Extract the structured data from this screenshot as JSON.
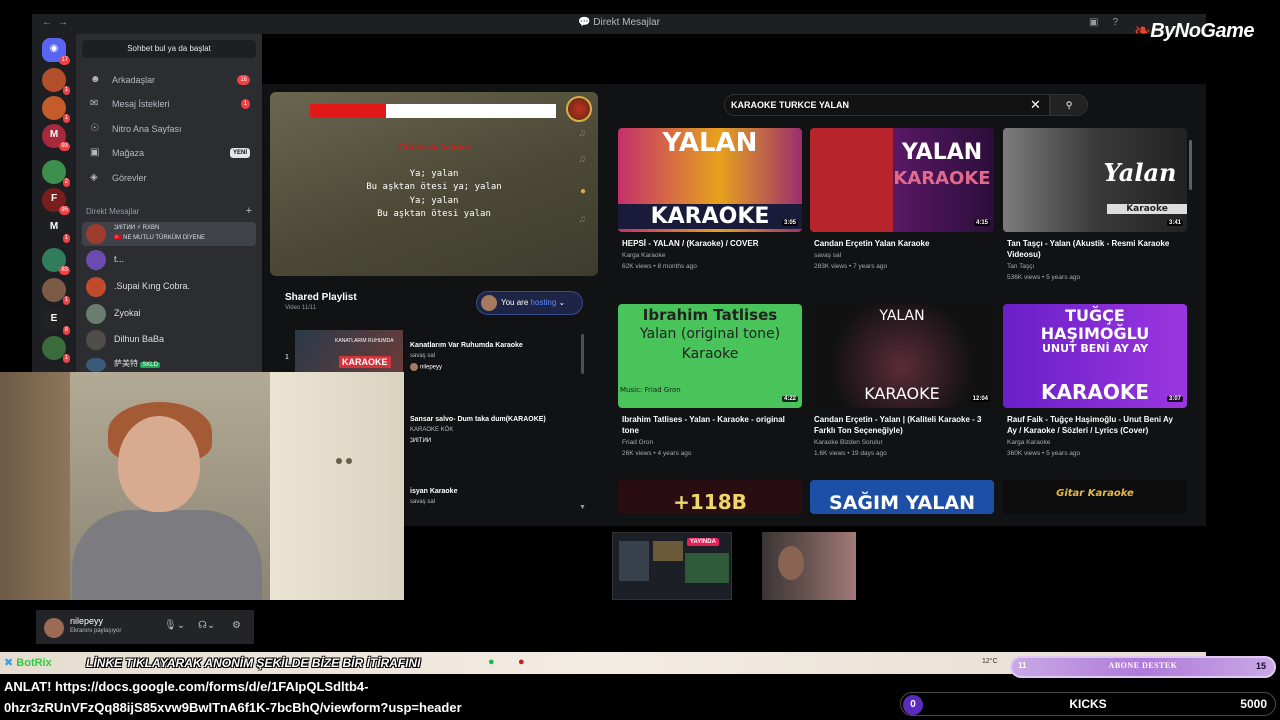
{
  "window": {
    "title": "Direkt Mesajlar"
  },
  "brand": {
    "logo": "ByNoGame"
  },
  "servers": [
    {
      "badge": "17"
    },
    {
      "badge": "1"
    },
    {
      "badge": "1"
    },
    {
      "badge": "93"
    },
    {
      "badge": "2"
    },
    {
      "badge": "95"
    },
    {
      "badge": "1"
    },
    {
      "badge": "83"
    },
    {
      "badge": "1"
    },
    {
      "badge": "8"
    },
    {
      "badge": "1"
    }
  ],
  "sidebar": {
    "search_placeholder": "Sohbet bul ya da başlat",
    "items": [
      {
        "label": "Arkadaşlar",
        "badge": "16"
      },
      {
        "label": "Mesaj İstekleri",
        "badge": "1"
      },
      {
        "label": "Nitro Ana Sayfası"
      },
      {
        "label": "Mağaza",
        "tag": "YENİ"
      },
      {
        "label": "Görevler"
      }
    ],
    "dm_header": "Direkt Mesajlar",
    "dms": [
      {
        "name": "ℷИITИИ ⚡ RXBN",
        "status": "🇹🇷 NE MUTLU TÜRKÜM DİYENE"
      },
      {
        "name": "t..."
      },
      {
        "name": ".Supai Kıng Cobra."
      },
      {
        "name": "Zyokai"
      },
      {
        "name": "Dilhun BaBa"
      },
      {
        "name": "萨美特",
        "tag": "SKLD"
      }
    ]
  },
  "user": {
    "name": "nilepeyy",
    "status": "Ekranını paylaşıyor"
  },
  "karaoke": {
    "progress": 0.31,
    "heading": "Ortalarda kalırım",
    "lines": [
      "Ya; yalan",
      "Bu aşktan ötesi ya; yalan",
      "Ya; yalan",
      "Bu aşktan ötesi yalan"
    ]
  },
  "playlist": {
    "title": "Shared Playlist",
    "subtitle": "Video 11/11",
    "host_prefix": "You are ",
    "host_word": "hosting",
    "items": [
      {
        "num": "1",
        "thumb_title": "KANATLARIM RUHUMDA",
        "thumb_label": "KARAOKE",
        "title": "Kanatlarım Var Ruhumda Karaoke",
        "channel": "savaş sal",
        "added_by": "nilepeyy"
      },
      {
        "title": "Sansar salvo- Dum taka dum(KARAOKE)",
        "channel": "KARAOKE KÖK",
        "added_by": "ℷИITИИ"
      },
      {
        "title": "isyan Karaoke",
        "channel": "savaş sal"
      }
    ]
  },
  "youtube": {
    "query": "KARAOKE TURKCE YALAN",
    "videos": [
      {
        "thumb": [
          "YALAN",
          "KARAOKE"
        ],
        "duration": "3:05",
        "title": "HEPSİ - YALAN / (Karaoke) / COVER",
        "channel": "Karga Karaoke",
        "meta": "62K views • 8 months ago"
      },
      {
        "thumb": [
          "YALAN",
          "KARAOKE"
        ],
        "duration": "4:15",
        "title": "Candan Erçetin Yalan Karaoke",
        "channel": "savaş sal",
        "meta": "283K views • 7 years ago"
      },
      {
        "thumb": [
          "Yalan",
          "Karaoke"
        ],
        "duration": "3:41",
        "title": "Tan Taşçı - Yalan (Akustik - Resmi Karaoke Videosu)",
        "channel": "Tan Taşçı",
        "meta": "536K views • 5 years ago"
      },
      {
        "thumb": [
          "Ibrahim Tatlises",
          "Yalan (original tone)",
          "Karaoke",
          "Music: Friad Gron"
        ],
        "duration": "4:22",
        "title": "Ibrahim Tatlises - Yalan - Karaoke - original tone",
        "channel": "Friad Gron",
        "meta": "26K views • 4 years ago"
      },
      {
        "thumb": [
          "YALAN",
          "KARAOKE"
        ],
        "duration": "12:04",
        "title": "Candan Erçetin - Yalan | (Kaliteli Karaoke - 3 Farklı Ton Seçeneğiyle)",
        "channel": "Karaoke Bizden Sorulur",
        "meta": "1.6K views • 19 days ago"
      },
      {
        "thumb": [
          "TUĞÇE",
          "HAŞIMOĞLU",
          "UNUT BENİ AY AY",
          "KARAOKE"
        ],
        "duration": "3:07",
        "title": "Rauf Faik - Tuğçe Haşimoğlu - Unut Beni Ay Ay / Karaoke / Sözleri / Lyrics (Cover)",
        "channel": "Karga Karaoke",
        "meta": "360K views • 5 years ago"
      },
      {
        "thumb": [
          "+118B"
        ]
      },
      {
        "thumb": [
          "SAĞIM YALAN"
        ]
      },
      {
        "thumb": [
          "Gitar Karaoke"
        ]
      }
    ]
  },
  "stream_preview": {
    "live": "YAYINDA"
  },
  "overlay": {
    "ticker_prefix": "BotRix",
    "ticker": "LİNKE TIKLAYARAK ANONİM ŞEKİLDE BİZE BİR İTİRAFINI",
    "weather": "12°C",
    "anlat": "ANLAT! https://docs.google.com/forms/d/e/1FAIpQLSdltb4-0hzr3zRUnVFzQq88ijS85xvw9BwITnA6f1K-7bcBhQ/viewform?usp=header",
    "abone": {
      "left": "11",
      "label": "ABONE DESTEK",
      "right": "15"
    },
    "kicks": {
      "count": "0",
      "label": "KICKS",
      "goal": "5000"
    }
  },
  "colors": {
    "discord_bg": "#2b2d31",
    "rail": "#1e1f22",
    "accent": "#5865f2",
    "danger": "#f23f43",
    "karaoke_red": "#e21919",
    "kick_purple": "#5b2bbf"
  }
}
